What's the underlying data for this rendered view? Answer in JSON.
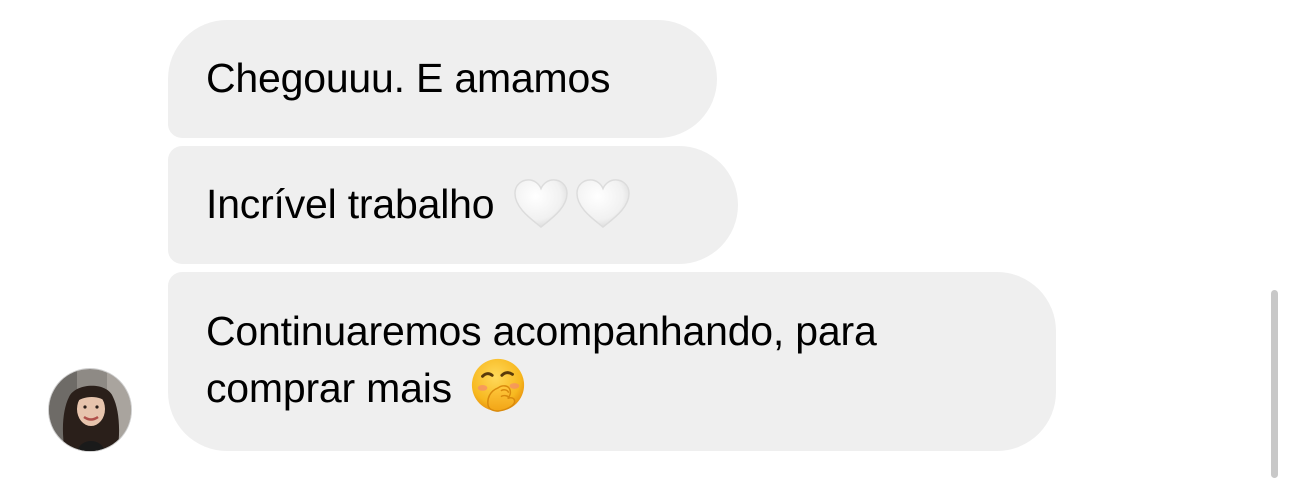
{
  "messages": [
    {
      "text": "Chegouuu. E amamos",
      "emojis": []
    },
    {
      "text": "Incrível trabalho",
      "emojis": [
        "white-heart-icon",
        "white-heart-icon"
      ]
    },
    {
      "line1": "Continuaremos acompanhando, para",
      "line2": "comprar mais",
      "emojis": [
        "face-with-hand-over-mouth-icon"
      ]
    }
  ],
  "colors": {
    "bubble_background": "#efefef",
    "text": "#000000",
    "heart_fill": "#f2f2f2",
    "emoji_face": "#f7b81f",
    "scrollbar": "#c8c8c8"
  },
  "avatar": {
    "icon": "profile-photo"
  }
}
